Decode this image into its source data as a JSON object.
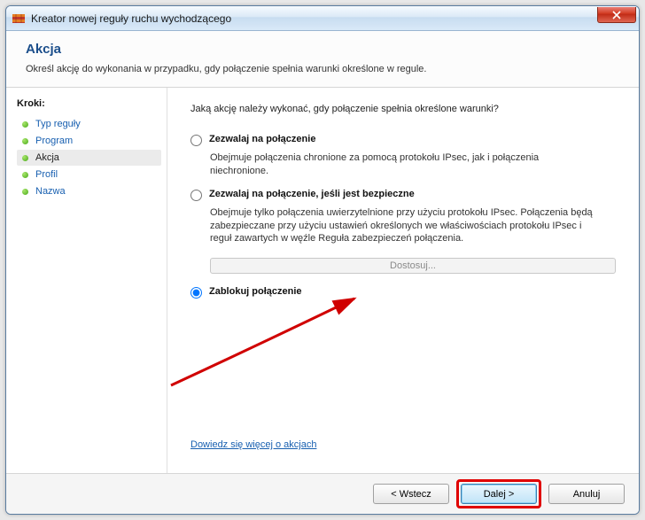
{
  "window": {
    "title": "Kreator nowej reguły ruchu wychodzącego"
  },
  "header": {
    "title": "Akcja",
    "subtitle": "Określ akcję do wykonania w przypadku, gdy połączenie spełnia warunki określone w regule."
  },
  "sidebar": {
    "label": "Kroki:",
    "items": [
      {
        "label": "Typ reguły",
        "selected": false
      },
      {
        "label": "Program",
        "selected": false
      },
      {
        "label": "Akcja",
        "selected": true
      },
      {
        "label": "Profil",
        "selected": false
      },
      {
        "label": "Nazwa",
        "selected": false
      }
    ]
  },
  "main": {
    "prompt": "Jaką akcję należy wykonać, gdy połączenie spełnia określone warunki?",
    "options": {
      "allow": {
        "title": "Zezwalaj na połączenie",
        "desc": "Obejmuje połączenia chronione za pomocą protokołu IPsec, jak i połączenia niechronione."
      },
      "allow_secure": {
        "title": "Zezwalaj na połączenie, jeśli jest bezpieczne",
        "desc": "Obejmuje tylko połączenia uwierzytelnione przy użyciu protokołu IPsec. Połączenia będą zabezpieczane przy użyciu ustawień określonych we właściwościach protokołu IPsec i reguł zawartych w węźle Reguła zabezpieczeń połączenia."
      },
      "block": {
        "title": "Zablokuj połączenie"
      }
    },
    "customize_label": "Dostosuj...",
    "learn_more": "Dowiedz się więcej o akcjach"
  },
  "buttons": {
    "back": "< Wstecz",
    "next": "Dalej >",
    "cancel": "Anuluj"
  }
}
